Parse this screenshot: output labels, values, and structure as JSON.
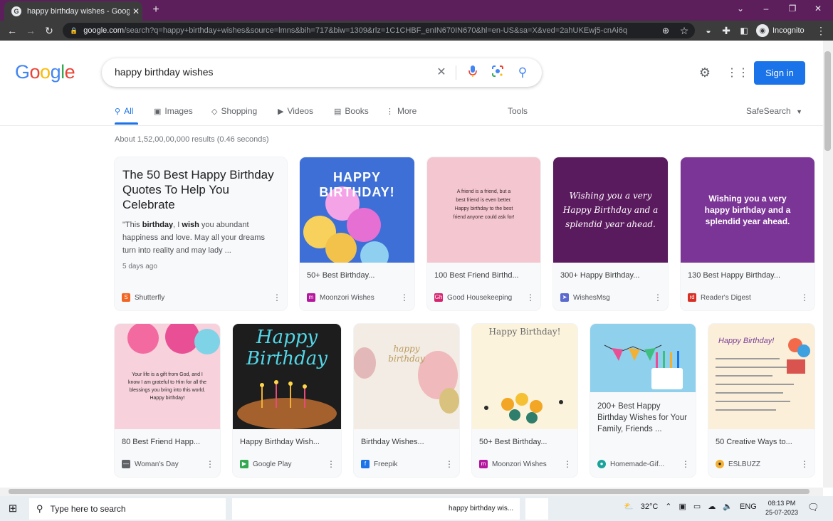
{
  "browser": {
    "tab_title": "happy birthday wishes - Google",
    "tab_favicon": "G",
    "url_host": "google.com",
    "url_path": "/search?q=happy+birthday+wishes&source=lmns&bih=717&biw=1309&rlz=1C1CHBF_enIN670IN670&hl=en-US&sa=X&ved=2ahUKEwj5-cnAi6q",
    "profile_label": "Incognito"
  },
  "header": {
    "logo_letters": [
      "G",
      "o",
      "o",
      "g",
      "l",
      "e"
    ],
    "logo_colors": [
      "#4285f4",
      "#ea4335",
      "#fbbc05",
      "#4285f4",
      "#34a853",
      "#ea4335"
    ],
    "query": "happy birthday wishes",
    "signin_label": "Sign in"
  },
  "search_tabs": {
    "all": "All",
    "images": "Images",
    "shopping": "Shopping",
    "videos": "Videos",
    "books": "Books",
    "more": "More",
    "tools": "Tools",
    "safesearch": "SafeSearch"
  },
  "results_stats": "About 1,52,00,00,000 results (0.46 seconds)",
  "featured": {
    "title": "The 50 Best Happy Birthday Quotes To Help You Celebrate",
    "snippet_pre": "\"This ",
    "snippet_b1": "birthday",
    "snippet_mid": ", I ",
    "snippet_b2": "wish",
    "snippet_post": " you abundant happiness and love. May all your dreams turn into reality and may lady ...",
    "age": "5 days ago",
    "source": "Shutterfly"
  },
  "row1": [
    {
      "caption": "50+ Best Birthday...",
      "source": "Moonzori Wishes",
      "img_text": "HAPPY BIRTHDAY!",
      "bg": "#3d6fd6",
      "badge": "#b5179e"
    },
    {
      "caption": "100 Best Friend Birthd...",
      "source": "Good Housekeeping",
      "img_text": "A friend is a friend, but a best friend is even better. Happy birthday to the best friend anyone could ask for!",
      "bg": "#f4c6cf",
      "badge": "#d6246e"
    },
    {
      "caption": "300+ Happy Birthday...",
      "source": "WishesMsg",
      "img_text": "Wishing you a very Happy Birthday and a splendid year ahead.",
      "bg": "#5a1a5e",
      "badge": "#5b6ad0"
    },
    {
      "caption": "130 Best Happy Birthday...",
      "source": "Reader's Digest",
      "img_text": "Wishing you a very happy birthday and a splendid year ahead.",
      "bg": "#7b3596",
      "badge": "#d93025"
    }
  ],
  "row2": [
    {
      "caption": "80 Best Friend Happ...",
      "source": "Woman's Day",
      "img_text": "Your life is a gift from God, and I know I am grateful to Him for all the blessings you bring into this world. Happy birthday!",
      "bg": "#f7d1dc",
      "badge": "#5f6368"
    },
    {
      "caption": "Happy Birthday Wish...",
      "source": "Google Play",
      "img_text": "Happy Birthday",
      "bg": "#1d1d1d",
      "badge": "#34a853"
    },
    {
      "caption": "Birthday Wishes...",
      "source": "Freepik",
      "img_text": "happy birthday",
      "bg": "#f3ece4",
      "badge": "#1a73e8"
    },
    {
      "caption": "50+ Best Birthday...",
      "source": "Moonzori Wishes",
      "img_text": "Happy Birthday!",
      "bg": "#fbf3dc",
      "badge": "#b5179e"
    },
    {
      "caption": "200+ Best Happy Birthday Wishes for Your Family, Friends ...",
      "source": "Homemade-Gif...",
      "img_text": "",
      "bg": "#8fd0ec",
      "badge": "#1aa39a"
    },
    {
      "caption": "50 Creative Ways to...",
      "source": "ESLBUZZ",
      "img_text": "Happy Birthday!",
      "bg": "#fbefd9",
      "badge": "#202124"
    }
  ],
  "taskbar": {
    "search_placeholder": "Type here to search",
    "app_label": "happy birthday wis...",
    "temperature": "32°C",
    "lang": "ENG",
    "time": "08:13 PM",
    "date": "25-07-2023"
  }
}
